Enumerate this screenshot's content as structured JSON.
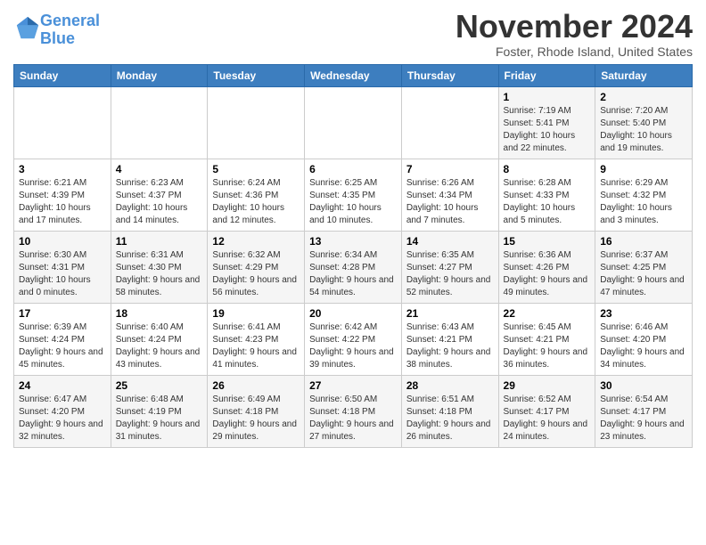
{
  "header": {
    "logo_line1": "General",
    "logo_line2": "Blue",
    "month": "November 2024",
    "location": "Foster, Rhode Island, United States"
  },
  "days_of_week": [
    "Sunday",
    "Monday",
    "Tuesday",
    "Wednesday",
    "Thursday",
    "Friday",
    "Saturday"
  ],
  "weeks": [
    [
      {
        "day": "",
        "info": ""
      },
      {
        "day": "",
        "info": ""
      },
      {
        "day": "",
        "info": ""
      },
      {
        "day": "",
        "info": ""
      },
      {
        "day": "",
        "info": ""
      },
      {
        "day": "1",
        "info": "Sunrise: 7:19 AM\nSunset: 5:41 PM\nDaylight: 10 hours and 22 minutes."
      },
      {
        "day": "2",
        "info": "Sunrise: 7:20 AM\nSunset: 5:40 PM\nDaylight: 10 hours and 19 minutes."
      }
    ],
    [
      {
        "day": "3",
        "info": "Sunrise: 6:21 AM\nSunset: 4:39 PM\nDaylight: 10 hours and 17 minutes."
      },
      {
        "day": "4",
        "info": "Sunrise: 6:23 AM\nSunset: 4:37 PM\nDaylight: 10 hours and 14 minutes."
      },
      {
        "day": "5",
        "info": "Sunrise: 6:24 AM\nSunset: 4:36 PM\nDaylight: 10 hours and 12 minutes."
      },
      {
        "day": "6",
        "info": "Sunrise: 6:25 AM\nSunset: 4:35 PM\nDaylight: 10 hours and 10 minutes."
      },
      {
        "day": "7",
        "info": "Sunrise: 6:26 AM\nSunset: 4:34 PM\nDaylight: 10 hours and 7 minutes."
      },
      {
        "day": "8",
        "info": "Sunrise: 6:28 AM\nSunset: 4:33 PM\nDaylight: 10 hours and 5 minutes."
      },
      {
        "day": "9",
        "info": "Sunrise: 6:29 AM\nSunset: 4:32 PM\nDaylight: 10 hours and 3 minutes."
      }
    ],
    [
      {
        "day": "10",
        "info": "Sunrise: 6:30 AM\nSunset: 4:31 PM\nDaylight: 10 hours and 0 minutes."
      },
      {
        "day": "11",
        "info": "Sunrise: 6:31 AM\nSunset: 4:30 PM\nDaylight: 9 hours and 58 minutes."
      },
      {
        "day": "12",
        "info": "Sunrise: 6:32 AM\nSunset: 4:29 PM\nDaylight: 9 hours and 56 minutes."
      },
      {
        "day": "13",
        "info": "Sunrise: 6:34 AM\nSunset: 4:28 PM\nDaylight: 9 hours and 54 minutes."
      },
      {
        "day": "14",
        "info": "Sunrise: 6:35 AM\nSunset: 4:27 PM\nDaylight: 9 hours and 52 minutes."
      },
      {
        "day": "15",
        "info": "Sunrise: 6:36 AM\nSunset: 4:26 PM\nDaylight: 9 hours and 49 minutes."
      },
      {
        "day": "16",
        "info": "Sunrise: 6:37 AM\nSunset: 4:25 PM\nDaylight: 9 hours and 47 minutes."
      }
    ],
    [
      {
        "day": "17",
        "info": "Sunrise: 6:39 AM\nSunset: 4:24 PM\nDaylight: 9 hours and 45 minutes."
      },
      {
        "day": "18",
        "info": "Sunrise: 6:40 AM\nSunset: 4:24 PM\nDaylight: 9 hours and 43 minutes."
      },
      {
        "day": "19",
        "info": "Sunrise: 6:41 AM\nSunset: 4:23 PM\nDaylight: 9 hours and 41 minutes."
      },
      {
        "day": "20",
        "info": "Sunrise: 6:42 AM\nSunset: 4:22 PM\nDaylight: 9 hours and 39 minutes."
      },
      {
        "day": "21",
        "info": "Sunrise: 6:43 AM\nSunset: 4:21 PM\nDaylight: 9 hours and 38 minutes."
      },
      {
        "day": "22",
        "info": "Sunrise: 6:45 AM\nSunset: 4:21 PM\nDaylight: 9 hours and 36 minutes."
      },
      {
        "day": "23",
        "info": "Sunrise: 6:46 AM\nSunset: 4:20 PM\nDaylight: 9 hours and 34 minutes."
      }
    ],
    [
      {
        "day": "24",
        "info": "Sunrise: 6:47 AM\nSunset: 4:20 PM\nDaylight: 9 hours and 32 minutes."
      },
      {
        "day": "25",
        "info": "Sunrise: 6:48 AM\nSunset: 4:19 PM\nDaylight: 9 hours and 31 minutes."
      },
      {
        "day": "26",
        "info": "Sunrise: 6:49 AM\nSunset: 4:18 PM\nDaylight: 9 hours and 29 minutes."
      },
      {
        "day": "27",
        "info": "Sunrise: 6:50 AM\nSunset: 4:18 PM\nDaylight: 9 hours and 27 minutes."
      },
      {
        "day": "28",
        "info": "Sunrise: 6:51 AM\nSunset: 4:18 PM\nDaylight: 9 hours and 26 minutes."
      },
      {
        "day": "29",
        "info": "Sunrise: 6:52 AM\nSunset: 4:17 PM\nDaylight: 9 hours and 24 minutes."
      },
      {
        "day": "30",
        "info": "Sunrise: 6:54 AM\nSunset: 4:17 PM\nDaylight: 9 hours and 23 minutes."
      }
    ]
  ]
}
